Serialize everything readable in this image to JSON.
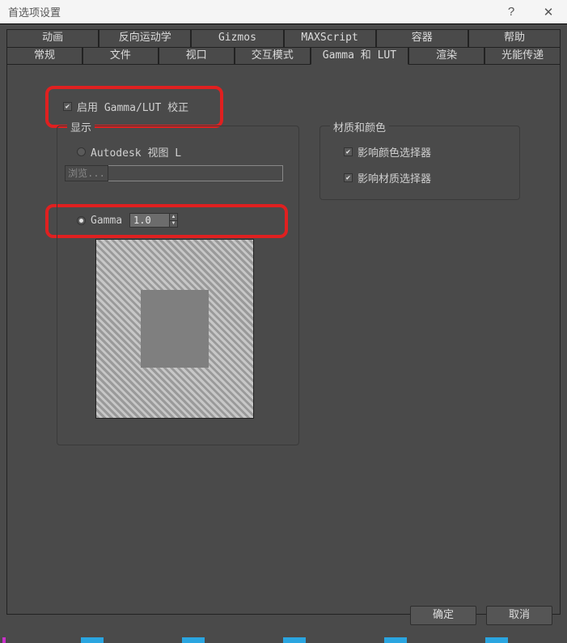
{
  "window": {
    "title": "首选项设置",
    "help_symbol": "?",
    "close_symbol": "✕"
  },
  "tabs_row1": [
    {
      "label": "动画"
    },
    {
      "label": "反向运动学"
    },
    {
      "label": "Gizmos"
    },
    {
      "label": "MAXScript"
    },
    {
      "label": "容器"
    },
    {
      "label": "帮助"
    }
  ],
  "tabs_row2": [
    {
      "label": "常规"
    },
    {
      "label": "文件"
    },
    {
      "label": "视口"
    },
    {
      "label": "交互模式"
    },
    {
      "label": "Gamma 和 LUT",
      "active": true
    },
    {
      "label": "渲染"
    },
    {
      "label": "光能传递"
    }
  ],
  "enable_gamma": {
    "checked": true,
    "label": "启用 Gamma/LUT 校正"
  },
  "display": {
    "group_label": "显示",
    "autodesk_radio": "Autodesk 视图 L",
    "browse_btn": "浏览...",
    "browse_value": "",
    "gamma_radio": "Gamma",
    "gamma_selected": true,
    "gamma_value": "1.0"
  },
  "material": {
    "group_label": "材质和颜色",
    "affect_color_picker": {
      "checked": true,
      "label": "影响颜色选择器"
    },
    "affect_material_picker": {
      "checked": true,
      "label": "影响材质选择器"
    }
  },
  "buttons": {
    "ok": "确定",
    "cancel": "取消"
  }
}
